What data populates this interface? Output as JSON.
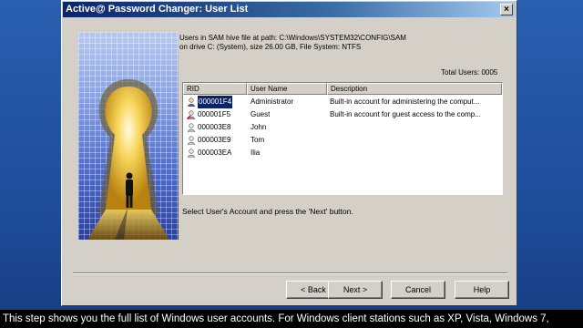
{
  "window": {
    "title": "Active@ Password Changer: User List",
    "close_label": "×"
  },
  "info": {
    "line1": "Users in SAM hive file at path: C:\\Windows\\SYSTEM32\\CONFIG\\SAM",
    "line2": "on drive C: (System), size 26.00 GB, File System: NTFS",
    "total_users": "Total Users: 0005"
  },
  "list": {
    "columns": [
      "RID",
      "User Name",
      "Description"
    ],
    "rows": [
      {
        "rid": "000001F4",
        "name": "Administrator",
        "description": "Built-in account for administering the comput...",
        "icon": "admin-user-icon",
        "selected": true
      },
      {
        "rid": "000001F5",
        "name": "Guest",
        "description": "Built-in account for guest access to the comp...",
        "icon": "disabled-user-icon",
        "selected": false
      },
      {
        "rid": "000003E8",
        "name": "John",
        "description": "",
        "icon": "user-icon",
        "selected": false
      },
      {
        "rid": "000003E9",
        "name": "Tom",
        "description": "",
        "icon": "user-icon",
        "selected": false
      },
      {
        "rid": "000003EA",
        "name": "Ilia",
        "description": "",
        "icon": "user-icon",
        "selected": false
      }
    ]
  },
  "instruction": "Select User's Account and press the 'Next' button.",
  "buttons": {
    "back": "< Back",
    "next": "Next >",
    "cancel": "Cancel",
    "help": "Help"
  },
  "caption": "This step shows you the full list of Windows user accounts. For Windows client stations such as XP, Vista, Windows 7,",
  "colors": {
    "titlebar": "#0a246a",
    "selection": "#0a246a",
    "dialog": "#d4d0c8",
    "desktop": "#1f4f9a"
  }
}
